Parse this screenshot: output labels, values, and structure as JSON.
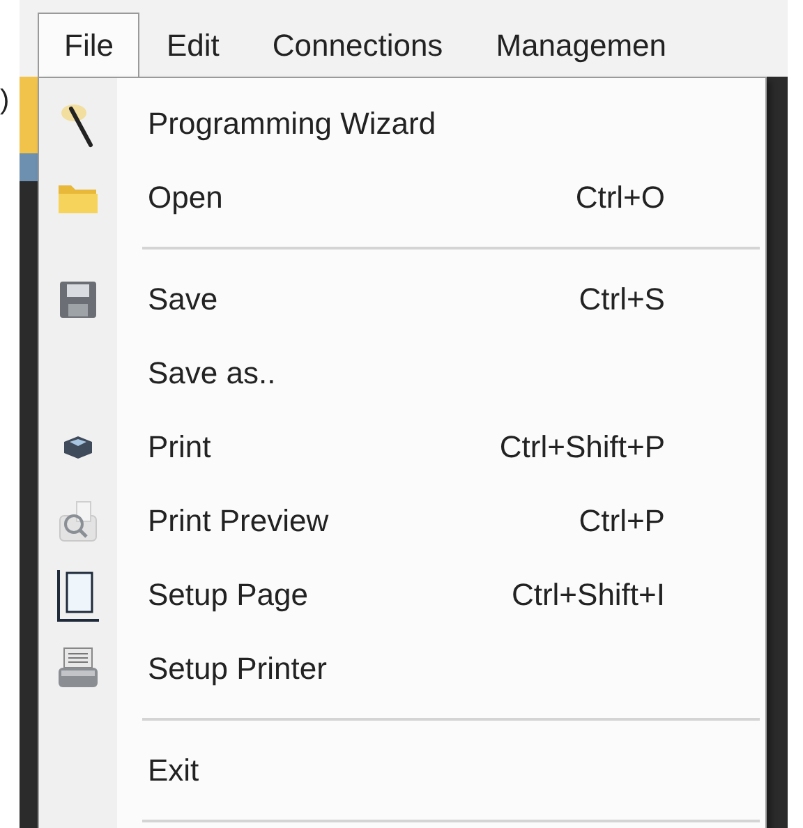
{
  "edge_text": ")",
  "menu_bar": [
    {
      "label": "File",
      "selected": true
    },
    {
      "label": "Edit",
      "selected": false
    },
    {
      "label": "Connections",
      "selected": false
    },
    {
      "label": "Managemen",
      "selected": false
    }
  ],
  "file_menu": [
    {
      "kind": "item",
      "label": "Programming Wizard"
    },
    {
      "kind": "item",
      "label": "Open",
      "shortcut": "Ctrl+O"
    },
    {
      "kind": "separator"
    },
    {
      "kind": "item",
      "label": "Save",
      "shortcut": "Ctrl+S"
    },
    {
      "kind": "item",
      "label": "Save as.."
    },
    {
      "kind": "item",
      "label": "Print",
      "shortcut": "Ctrl+Shift+P"
    },
    {
      "kind": "item",
      "label": "Print Preview",
      "shortcut": "Ctrl+P"
    },
    {
      "kind": "item",
      "label": "Setup Page",
      "shortcut": "Ctrl+Shift+I"
    },
    {
      "kind": "item",
      "label": "Setup Printer"
    },
    {
      "kind": "separator"
    },
    {
      "kind": "item",
      "label": "Exit"
    },
    {
      "kind": "separator"
    }
  ]
}
